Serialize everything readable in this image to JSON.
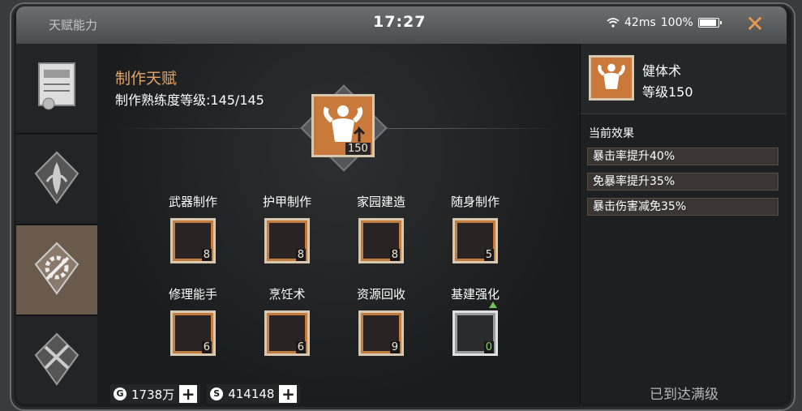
{
  "window": {
    "title": "天赋能力",
    "time": "17:27",
    "ping": "42ms",
    "battery": "100%",
    "battery_level": 1.0,
    "close_icon": "close-x-icon"
  },
  "sidebar": {
    "items": [
      {
        "name": "certificate",
        "icon": "certificate-icon",
        "active": false
      },
      {
        "name": "plant",
        "icon": "leaf-icon",
        "active": false
      },
      {
        "name": "crafting",
        "icon": "gear-hammer-icon",
        "active": true
      },
      {
        "name": "tools",
        "icon": "wrench-hammer-icon",
        "active": false
      }
    ]
  },
  "main": {
    "title": "制作天赋",
    "proficiency": "制作熟练度等级:145/145",
    "hero": {
      "icon": "muscle-man-icon",
      "level": "150"
    },
    "skills": [
      {
        "label": "武器制作",
        "level": "8",
        "icon": "gun-icon"
      },
      {
        "label": "护甲制作",
        "level": "8",
        "icon": "armor-icon"
      },
      {
        "label": "家园建造",
        "level": "8",
        "icon": "build-icon"
      },
      {
        "label": "随身制作",
        "level": "5",
        "icon": "toolbox-icon"
      },
      {
        "label": "修理能手",
        "level": "6",
        "icon": "calculator-icon"
      },
      {
        "label": "烹饪术",
        "level": "6",
        "icon": "cooking-icon"
      },
      {
        "label": "资源回收",
        "level": "9",
        "icon": "screwdriver-icon"
      },
      {
        "label": "基建强化",
        "level": "0",
        "icon": "road-icon"
      }
    ],
    "resources": {
      "gold": "1738万",
      "silver": "414148"
    }
  },
  "right_panel": {
    "name": "健体术",
    "level": "等级150",
    "effects_title": "当前效果",
    "effects": [
      "暴击率提升40%",
      "免暴率提升35%",
      "暴击伤害减免35%"
    ],
    "status": "已到达满级"
  },
  "colors": {
    "accent": "#e2a468",
    "tile": "#c27c40",
    "active_tab": "#6a5a4c"
  }
}
